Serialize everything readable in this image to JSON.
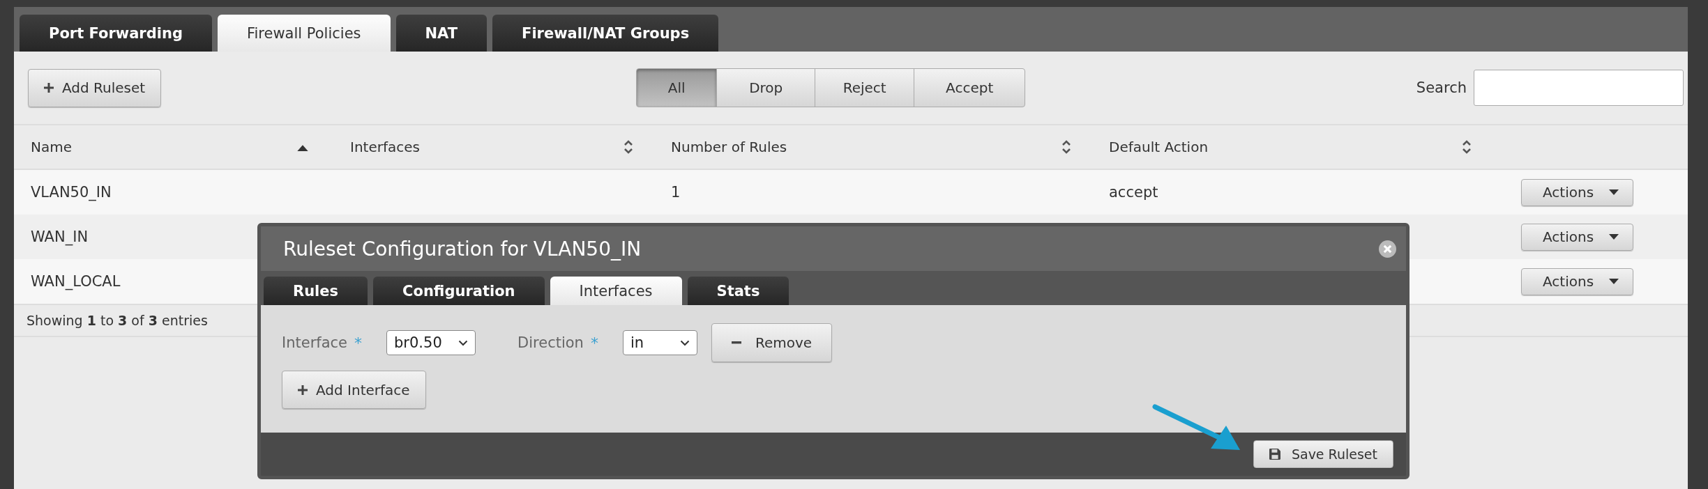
{
  "top_tabs": [
    {
      "label": "Port Forwarding",
      "selected": false
    },
    {
      "label": "Firewall Policies",
      "selected": true
    },
    {
      "label": "NAT",
      "selected": false
    },
    {
      "label": "Firewall/NAT Groups",
      "selected": false
    }
  ],
  "toolbar": {
    "add_button": "Add Ruleset",
    "filters": [
      {
        "label": "All",
        "selected": true
      },
      {
        "label": "Drop",
        "selected": false
      },
      {
        "label": "Reject",
        "selected": false
      },
      {
        "label": "Accept",
        "selected": false
      }
    ],
    "search": {
      "label": "Search"
    }
  },
  "table": {
    "columns": [
      {
        "label": "Name",
        "sorted_ascending": true
      },
      {
        "label": "Interfaces",
        "sorted_ascending": false
      },
      {
        "label": "Number of Rules",
        "sorted_ascending": false
      },
      {
        "label": "Default Action",
        "sorted_ascending": false
      }
    ],
    "rows": [
      {
        "name": "VLAN50_IN",
        "rules": "1",
        "default_action": "accept",
        "actions": "Actions"
      },
      {
        "name": "WAN_IN",
        "actions": "Actions"
      },
      {
        "name": "WAN_LOCAL",
        "actions": "Actions"
      }
    ],
    "footer": "Showing **1** to **3** of **3** entries"
  },
  "modal": {
    "title": "Ruleset Configuration for VLAN50_IN",
    "tabs": [
      {
        "label": "Rules",
        "selected": false
      },
      {
        "label": "Configuration",
        "selected": false
      },
      {
        "label": "Interfaces",
        "selected": true
      },
      {
        "label": "Stats",
        "selected": false
      }
    ],
    "fields": [
      {
        "label": "Interface",
        "required_mark": "*",
        "value": "br0.50"
      },
      {
        "label": "Direction",
        "required_mark": "*",
        "value": "in"
      }
    ],
    "remove_button": "Remove",
    "add_button": "Add Interface",
    "save_button": "Save Ruleset"
  }
}
